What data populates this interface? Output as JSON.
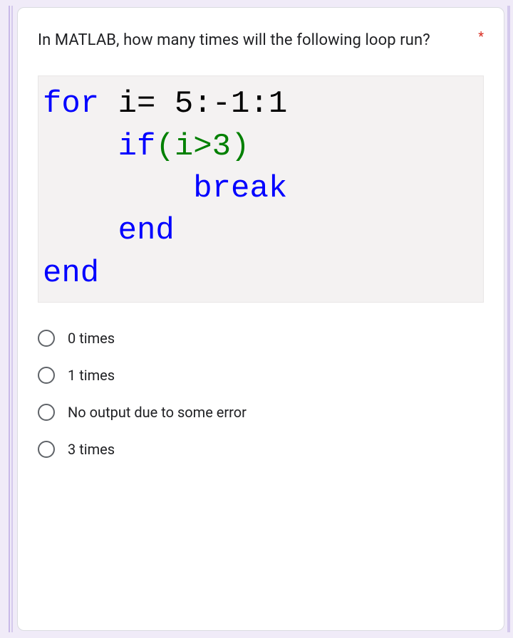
{
  "question": {
    "text": "In MATLAB, how many times will the following loop run?",
    "required_mark": "*"
  },
  "code": {
    "line1_kw": "for",
    "line1_rest": " i= 5:-1:1",
    "line2_indent": "    ",
    "line2_kw": "if",
    "line2_paren": "(i>3)",
    "line3_indent": "        ",
    "line3_kw": "break",
    "line4_indent": "    ",
    "line4_kw": "end",
    "line5_kw": "end"
  },
  "options": [
    {
      "label": "0 times"
    },
    {
      "label": "1 times"
    },
    {
      "label": "No output due to some error"
    },
    {
      "label": "3 times"
    }
  ]
}
